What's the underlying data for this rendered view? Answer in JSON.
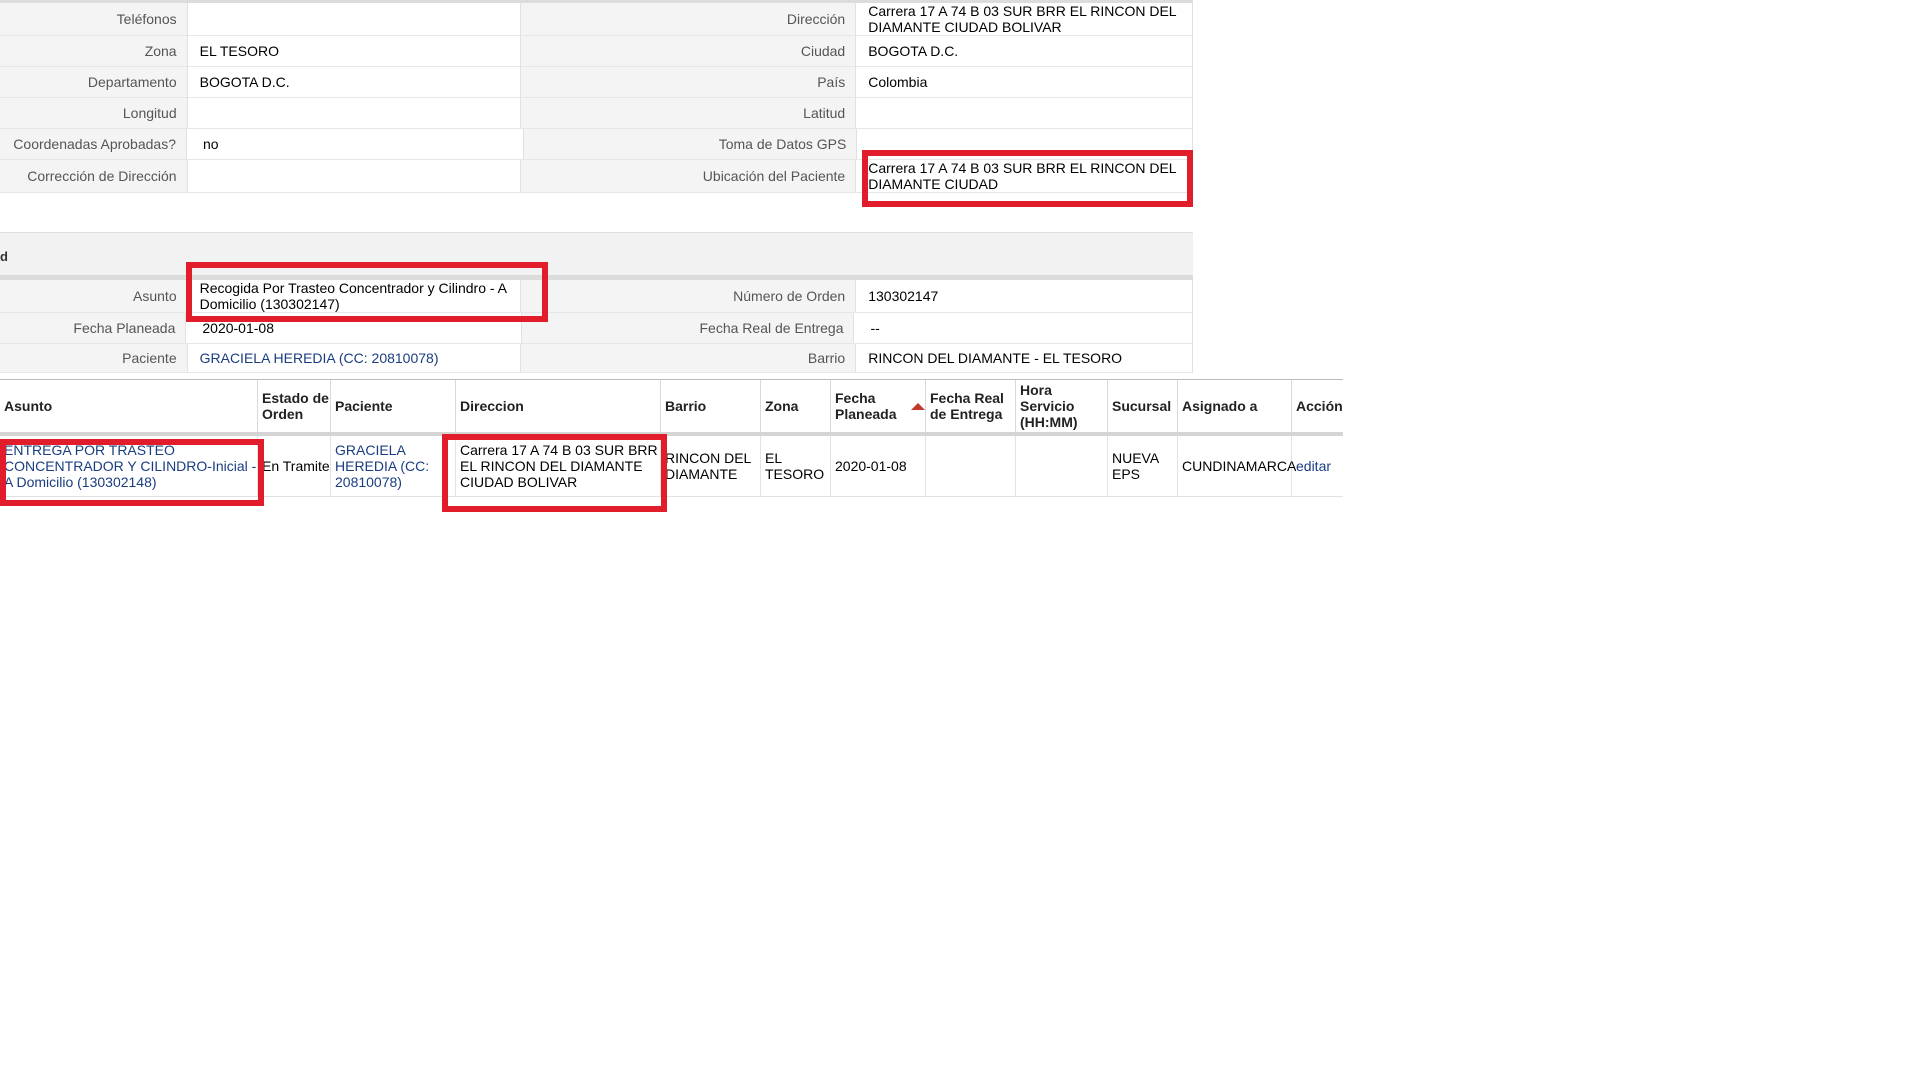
{
  "patient_details": {
    "rows": [
      {
        "left_label": "Teléfonos",
        "left_value": "",
        "right_label": "Dirección",
        "right_value": "Carrera 17 A 74 B 03 SUR BRR EL RINCON DEL DIAMANTE CIUDAD BOLIVAR"
      },
      {
        "left_label": "Zona",
        "left_value": "EL TESORO",
        "right_label": "Ciudad",
        "right_value": "BOGOTA D.C."
      },
      {
        "left_label": "Departamento",
        "left_value": "BOGOTA D.C.",
        "right_label": "País",
        "right_value": "Colombia"
      },
      {
        "left_label": "Longitud",
        "left_value": "",
        "right_label": "Latitud",
        "right_value": ""
      },
      {
        "left_label": "Coordenadas Aprobadas?",
        "left_value": "no",
        "right_label": "Toma de Datos GPS",
        "right_value": ""
      },
      {
        "left_label": "Corrección de Dirección",
        "left_value": "",
        "right_label": "Ubicación del Paciente",
        "right_value": "Carrera 17 A 74 B 03 SUR BRR EL RINCON DEL DIAMANTE CIUDAD"
      }
    ]
  },
  "section_header": {
    "title": "d"
  },
  "order_details": {
    "rows": [
      {
        "left_label": "Asunto",
        "left_value": "Recogida Por Trasteo Concentrador y Cilindro - A Domicilio (130302147)",
        "right_label": "Número de Orden",
        "right_value": "130302147"
      },
      {
        "left_label": "Fecha Planeada",
        "left_value": "2020-01-08",
        "right_label": "Fecha Real de Entrega",
        "right_value": "--"
      },
      {
        "left_label": "Paciente",
        "left_value": "GRACIELA HEREDIA (CC: 20810078)",
        "right_label": "Barrio",
        "right_value": "RINCON DEL DIAMANTE - EL TESORO"
      }
    ]
  },
  "orders_table": {
    "columns": [
      "Asunto",
      "Estado de Orden",
      "Paciente",
      "Direccion",
      "Barrio",
      "Zona",
      "Fecha Planeada",
      "Fecha Real de Entrega",
      "Hora Servicio (HH:MM)",
      "Sucursal",
      "Asignado a",
      "Acción"
    ],
    "sorted_column": "Fecha Planeada",
    "rows": [
      {
        "asunto": "ENTREGA POR TRASTEO CONCENTRADOR Y CILINDRO-Inicial - A Domicilio (130302148)",
        "estado": "En Tramite",
        "paciente": "GRACIELA HEREDIA (CC: 20810078)",
        "direccion": "Carrera 17 A 74 B 03 SUR BRR EL RINCON DEL DIAMANTE CIUDAD BOLIVAR",
        "barrio": "RINCON DEL DIAMANTE",
        "zona": "EL TESORO",
        "fecha_planeada": "2020-01-08",
        "fecha_real": "",
        "hora": "",
        "sucursal": "NUEVA EPS",
        "asignado": "CUNDINAMARCA",
        "accion": "editar"
      }
    ]
  },
  "colors": {
    "highlight": "#e21d2b",
    "link": "#1a3d80",
    "label_bg": "#f4f4f4"
  }
}
